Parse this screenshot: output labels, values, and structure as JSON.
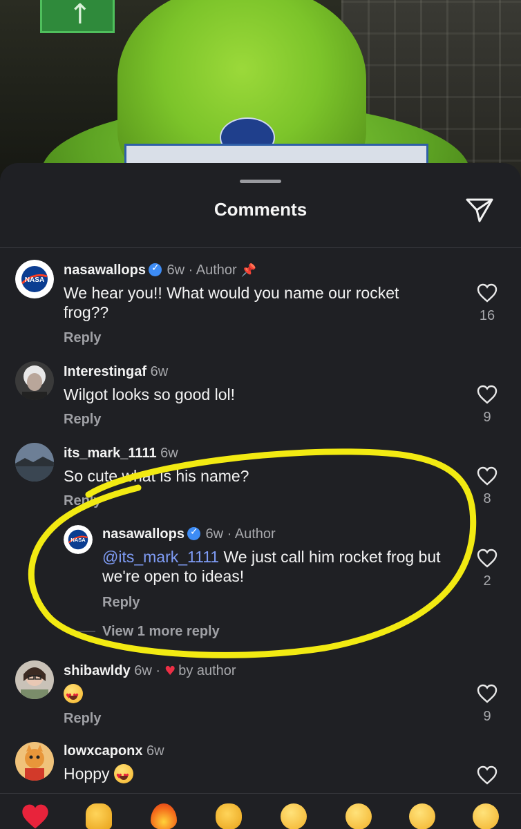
{
  "sheet": {
    "title": "Comments"
  },
  "comments": [
    {
      "username": "nasawallops",
      "verified": true,
      "time": "6w",
      "tag": "· Author",
      "pinned": true,
      "text": "We hear you!! What would you name our rocket frog??",
      "reply_label": "Reply",
      "likes": "16"
    },
    {
      "username": "Interestingaf",
      "time": "6w",
      "text": "Wilgot looks so good lol!",
      "reply_label": "Reply",
      "likes": "9"
    },
    {
      "username": "its_mark_1111",
      "time": "6w",
      "text": "So cute what is his name?",
      "reply_label": "Reply",
      "likes": "8"
    },
    {
      "username": "nasawallops",
      "verified": true,
      "time": "6w",
      "tag": "· Author",
      "mention": "@its_mark_1111",
      "text": " We just call him rocket frog but we're open to ideas!",
      "reply_label": "Reply",
      "likes": "2",
      "view_more": "View 1 more reply"
    },
    {
      "username": "shibawldy",
      "time": "6w",
      "liked_by": "by author",
      "text": "😍",
      "reply_label": "Reply",
      "likes": "9"
    },
    {
      "username": "lowxcaponx",
      "time": "6w",
      "text": "Hoppy",
      "reply_label": "",
      "likes": ""
    }
  ],
  "reactions": [
    "❤️",
    "🙌",
    "🔥",
    "👏",
    "😢",
    "😍",
    "😮",
    "😂"
  ],
  "colors": {
    "sheet_bg": "#1f2024",
    "annotation": "#f2ea12",
    "verified": "#3d8cf5",
    "mention": "#7f9cf5",
    "heart": "#ec2f45"
  }
}
